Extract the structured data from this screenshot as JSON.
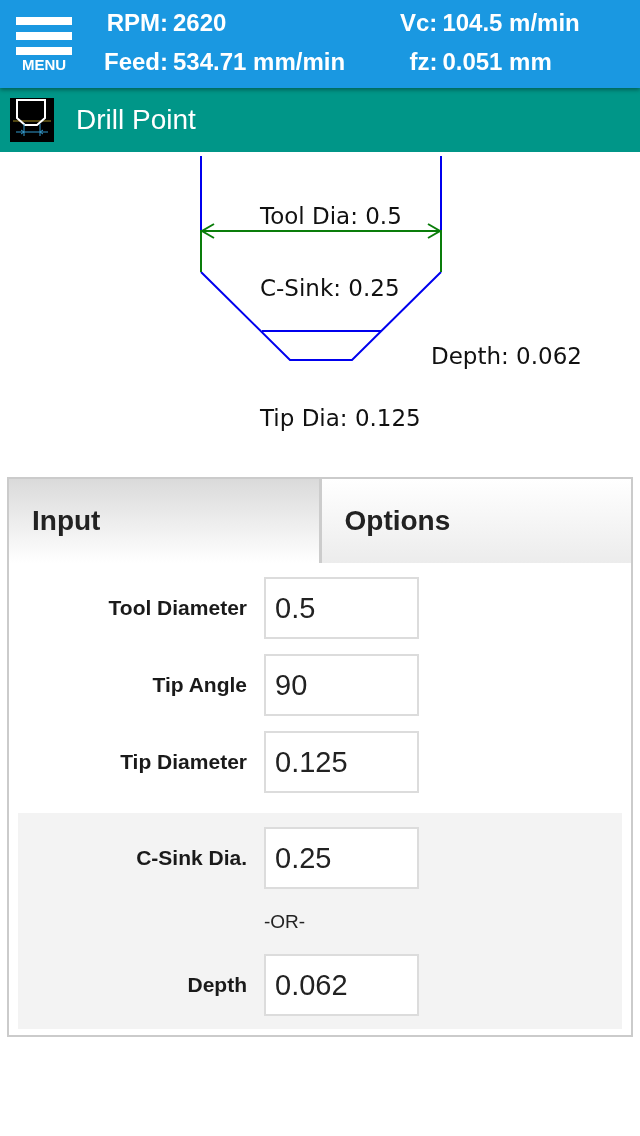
{
  "header": {
    "menu_button": {
      "label": "MENU"
    },
    "stats": [
      {
        "label": "RPM:",
        "value": "2620"
      },
      {
        "label": "Vc:",
        "value": "104.5 m/min"
      },
      {
        "label": "Feed:",
        "value": "534.71 mm/min"
      },
      {
        "label": "fz:",
        "value": "0.051 mm"
      }
    ]
  },
  "title_bar": {
    "title": "Drill Point"
  },
  "diagram": {
    "labels": [
      "Tool Dia: 0.5",
      "C-Sink: 0.25",
      "Depth: 0.062",
      "Tip Dia: 0.125"
    ]
  },
  "tabs": [
    {
      "label": "Input",
      "selected": true
    },
    {
      "label": "Options",
      "selected": false
    }
  ],
  "form": {
    "fields": [
      {
        "label": "Tool Diameter",
        "value": "0.5"
      },
      {
        "label": "Tip Angle",
        "value": "90"
      },
      {
        "label": "Tip Diameter",
        "value": "0.125"
      }
    ],
    "group": {
      "items": [
        {
          "kind": "field",
          "label": "C-Sink Dia.",
          "value": "0.25"
        },
        {
          "kind": "separator",
          "text": "-OR-"
        },
        {
          "kind": "field",
          "label": "Depth",
          "value": "0.062"
        }
      ]
    }
  }
}
